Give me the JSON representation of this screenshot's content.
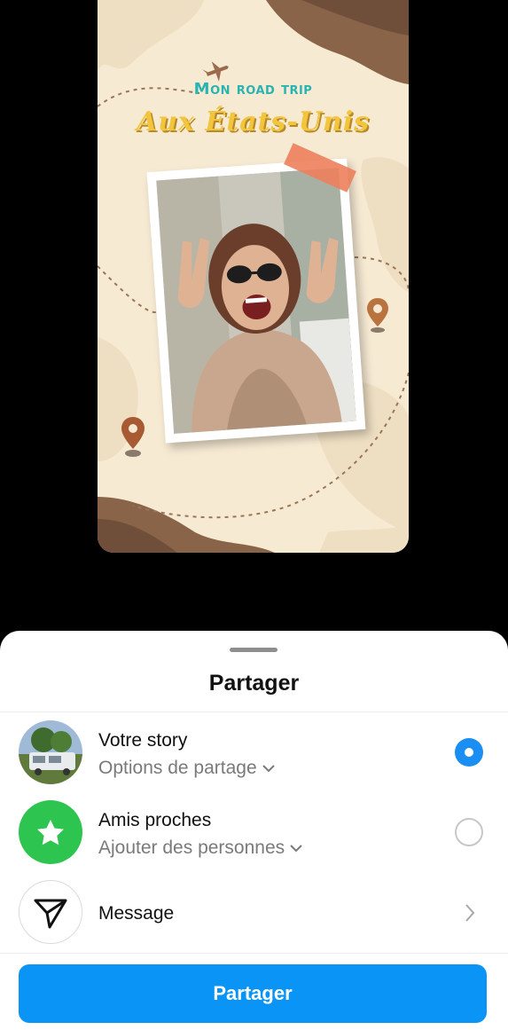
{
  "story": {
    "title_line1": "Mon road trip",
    "title_line2": "Aux États-Unis"
  },
  "sheet": {
    "title": "Partager",
    "options": [
      {
        "title": "Votre story",
        "subtitle": "Options de partage",
        "selected": true,
        "icon": "story-thumbnail"
      },
      {
        "title": "Amis proches",
        "subtitle": "Ajouter des personnes",
        "selected": false,
        "icon": "star-icon"
      },
      {
        "title": "Message",
        "icon": "send-icon",
        "trailing": "chevron-right-icon"
      }
    ],
    "button_label": "Partager"
  },
  "colors": {
    "accent": "#0a95f6",
    "radio_checked": "#1a8ef2",
    "close_friends_green": "#2ec450",
    "story_bg": "#f7ead3"
  }
}
